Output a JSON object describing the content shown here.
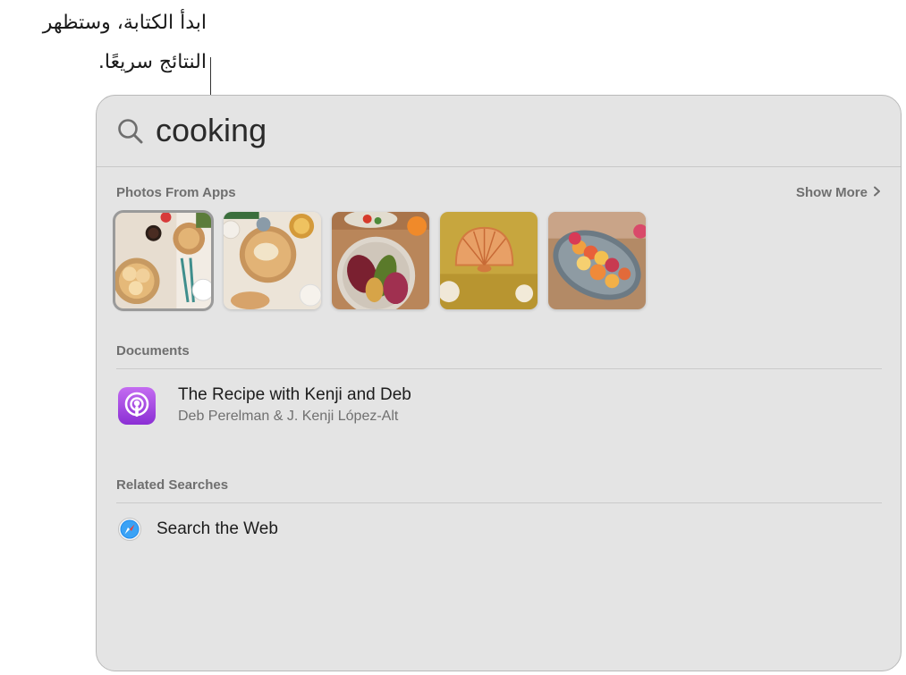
{
  "annotation": {
    "line1": "ابدأ الكتابة، وستظهر",
    "line2": "النتائج سريعًا."
  },
  "search": {
    "query": "cooking",
    "icon": "magnifying-glass-icon"
  },
  "sections": {
    "photos": {
      "header": "Photos From Apps",
      "show_more": "Show More",
      "show_more_icon": "chevron-right-icon",
      "selected_index": 0
    },
    "documents": {
      "header": "Documents",
      "item": {
        "title": "The Recipe with Kenji and Deb",
        "subtitle": "Deb Perelman & J. Kenji López-Alt",
        "icon": "podcasts-icon"
      }
    },
    "related": {
      "header": "Related Searches",
      "item": {
        "label": "Search the Web",
        "icon": "safari-compass-icon"
      }
    }
  },
  "colors": {
    "window_bg": "#e4e4e4",
    "podcast_purple": "#9b3fdf",
    "safari_blue": "#1e8cf0",
    "secondary_text": "#6f6f6f"
  }
}
